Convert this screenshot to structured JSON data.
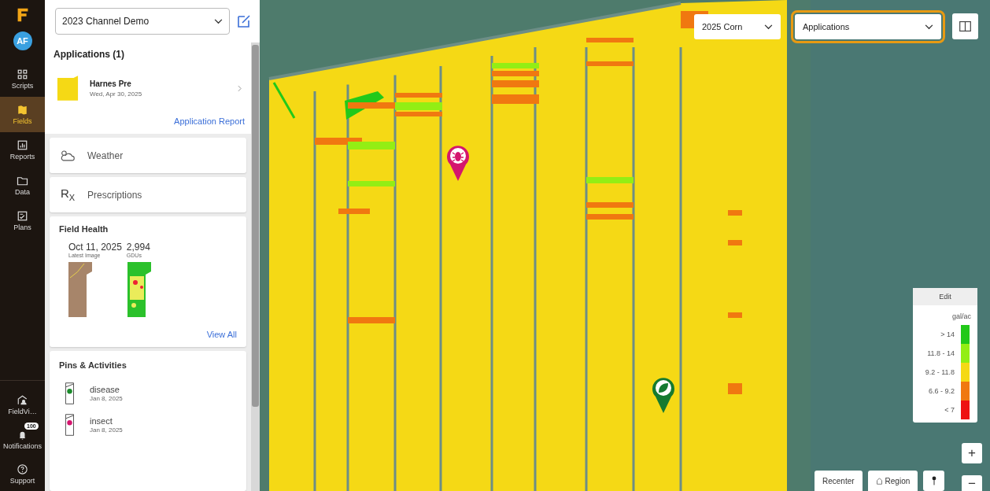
{
  "nav": {
    "avatar": "AF",
    "items": [
      {
        "label": "Scripts",
        "selected": false
      },
      {
        "label": "Fields",
        "selected": true
      },
      {
        "label": "Reports",
        "selected": false
      },
      {
        "label": "Data",
        "selected": false
      },
      {
        "label": "Plans",
        "selected": false
      }
    ],
    "bottom": [
      {
        "label": "FieldVi…"
      },
      {
        "label": "Notifications",
        "badge": "100"
      },
      {
        "label": "Support"
      }
    ]
  },
  "panel": {
    "operation": "2023 Channel Demo",
    "applications": {
      "title": "Applications (1)",
      "items": [
        {
          "name": "Harnes Pre",
          "date": "Wed, Apr 30, 2025"
        }
      ],
      "report_link": "Application Report"
    },
    "cards": [
      {
        "label": "Weather"
      },
      {
        "label": "Prescriptions",
        "symbol": "R$_{X}$"
      }
    ],
    "field_health": {
      "title": "Field Health",
      "stats": [
        {
          "value": "Oct 11, 2025",
          "label": "Latest Image"
        },
        {
          "value": "2,994",
          "label": "GDUs"
        }
      ],
      "link": "View All"
    },
    "pins": {
      "title": "Pins & Activities",
      "items": [
        {
          "name": "disease",
          "date": "Jan 8, 2025",
          "color": "#1a8a2a"
        },
        {
          "name": "insect",
          "date": "Jan 8, 2025",
          "color": "#d4166e"
        }
      ]
    }
  },
  "map": {
    "season": "2025 Corn",
    "layer": "Applications",
    "legend": {
      "edit": "Edit",
      "unit": "gal/ac",
      "entries": [
        {
          "label": "> 14",
          "color": "#22c91a"
        },
        {
          "label": "11.8 - 14",
          "color": "#93ee14"
        },
        {
          "label": "9.2 - 11.8",
          "color": "#f5d915"
        },
        {
          "label": "6.6 - 9.2",
          "color": "#f07810"
        },
        {
          "label": "< 7",
          "color": "#ee1111"
        }
      ]
    },
    "buttons": [
      "Recenter",
      "Region"
    ],
    "zoom_in": "+",
    "zoom_out": "−"
  }
}
